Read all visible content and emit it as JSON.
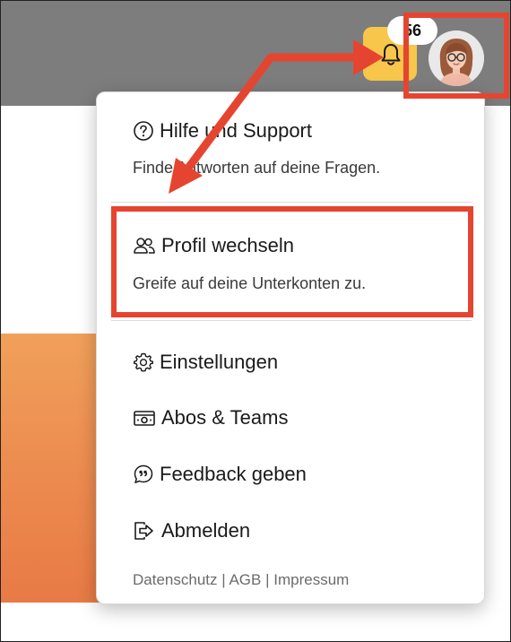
{
  "header": {
    "notification_count": "56",
    "bell_icon": "bell-icon",
    "avatar_icon": "avatar-user-icon"
  },
  "menu": {
    "help": {
      "title": "Hilfe und Support",
      "subtitle": "Finde Antworten auf deine Fragen.",
      "icon": "question-circle-icon"
    },
    "switch_profile": {
      "title": "Profil wechseln",
      "subtitle": "Greife auf deine Unterkonten zu.",
      "icon": "users-icon"
    },
    "settings": {
      "title": "Einstellungen",
      "icon": "gear-icon"
    },
    "subscriptions": {
      "title": "Abos & Teams",
      "icon": "banknote-icon"
    },
    "feedback": {
      "title": "Feedback geben",
      "icon": "quote-bubble-icon"
    },
    "logout": {
      "title": "Abmelden",
      "icon": "logout-icon"
    },
    "footer": {
      "privacy": "Datenschutz",
      "separator": "|",
      "terms": "AGB",
      "imprint": "Impressum"
    }
  },
  "colors": {
    "topbar": "#7d7d7d",
    "bell_bg": "#f7c64a",
    "annotation_red": "#e54530",
    "orange_bg": "#ec8a4f"
  }
}
